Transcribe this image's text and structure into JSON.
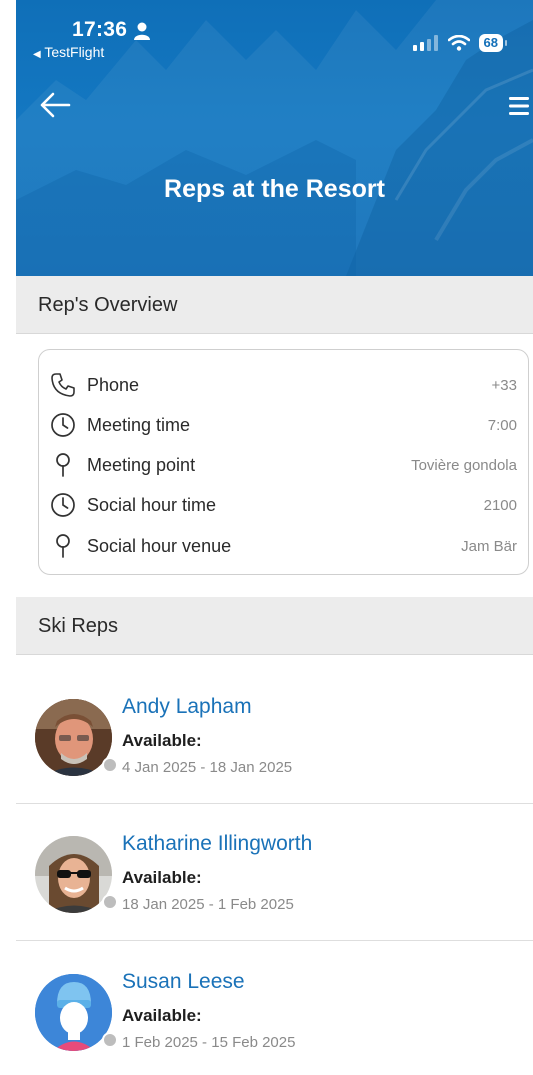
{
  "status_bar": {
    "time": "17:36",
    "back_app": "TestFlight",
    "battery": "68"
  },
  "header": {
    "title": "Reps at the Resort"
  },
  "overview": {
    "heading": "Rep's Overview",
    "rows": [
      {
        "icon": "phone-icon",
        "label": "Phone",
        "value": "+33"
      },
      {
        "icon": "clock-icon",
        "label": "Meeting time",
        "value": "7:00"
      },
      {
        "icon": "map-pin-icon",
        "label": "Meeting point",
        "value": "Tovière gondola"
      },
      {
        "icon": "clock-icon",
        "label": "Social hour time",
        "value": "2100"
      },
      {
        "icon": "map-pin-icon",
        "label": "Social hour venue",
        "value": "Jam Bär"
      }
    ]
  },
  "ski_reps": {
    "heading": "Ski Reps",
    "available_label": "Available:",
    "reps": [
      {
        "name": "Andy Lapham",
        "available_label": "Available:",
        "dates": "4 Jan 2025 - 18 Jan 2025"
      },
      {
        "name": "Katharine Illingworth",
        "available_label": "Available:",
        "dates": "18 Jan 2025 - 1 Feb 2025"
      },
      {
        "name": "Susan Leese",
        "available_label": "Available:",
        "dates": "1 Feb 2025 - 15 Feb 2025"
      }
    ]
  },
  "colors": {
    "header_blue": "#136fb8",
    "name_blue": "#1a72b8",
    "section_grey": "#ececec"
  }
}
